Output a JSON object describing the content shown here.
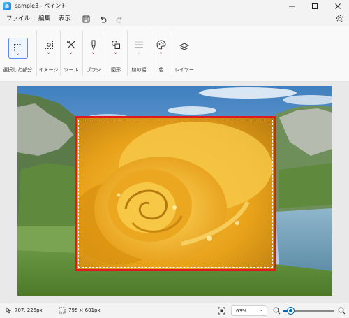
{
  "window": {
    "title": "sample3 - ペイント",
    "controls": [
      "minimize-icon",
      "maximize-icon",
      "close-icon"
    ]
  },
  "menu": {
    "items": [
      "ファイル",
      "編集",
      "表示"
    ],
    "quick_actions": [
      "save-icon",
      "undo-icon",
      "redo-icon"
    ],
    "settings_icon": "gear-icon"
  },
  "ribbon": {
    "groups": [
      {
        "label": "選択した部分",
        "icon": "selection-icon"
      },
      {
        "label": "イメージ",
        "icon": "image-icon"
      },
      {
        "label": "ツール",
        "icon": "tools-icon"
      },
      {
        "label": "ブラシ",
        "icon": "brush-icon"
      },
      {
        "label": "図形",
        "icon": "shapes-icon"
      },
      {
        "label": "線の幅",
        "icon": "line-width-icon"
      },
      {
        "label": "色",
        "icon": "palette-icon"
      },
      {
        "label": "レイヤー",
        "icon": "layers-icon"
      }
    ]
  },
  "canvas": {
    "background": "mountain lake landscape",
    "selection": "yellow rose",
    "selection_color": "#e01b1b"
  },
  "status": {
    "cursor_position": "707, 225px",
    "selection_size": "795 × 601px",
    "zoom": "63%",
    "zoom_level": 0.14,
    "accent_color": "#0067c0"
  }
}
